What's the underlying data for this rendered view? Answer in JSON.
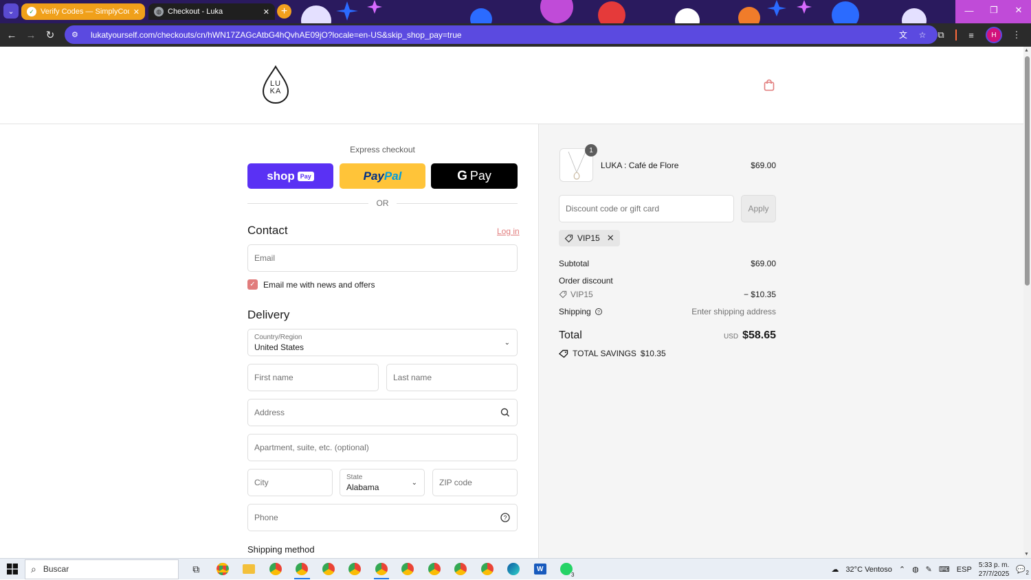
{
  "browser": {
    "tabs": [
      {
        "title": "Verify Codes — SimplyCodes",
        "active": false
      },
      {
        "title": "Checkout - Luka",
        "active": true
      }
    ],
    "url": "lukatyourself.com/checkouts/cn/hWN17ZAGcAtbG4hQvhAE09jO?locale=en-US&skip_shop_pay=true",
    "profile_initial": "H",
    "accent": "#5b4ae0"
  },
  "header": {
    "logo_line1": "LU",
    "logo_line2": "KA"
  },
  "express": {
    "label": "Express checkout",
    "shop_pay": "shop",
    "shop_pay_tag": "Pay",
    "paypal_a": "Pay",
    "paypal_b": "Pal",
    "gpay_g": "G",
    "gpay_text": "Pay",
    "or": "OR"
  },
  "contact": {
    "title": "Contact",
    "login": "Log in",
    "email_placeholder": "Email",
    "newsletter_label": "Email me with news and offers",
    "newsletter_checked": true
  },
  "delivery": {
    "title": "Delivery",
    "country_label": "Country/Region",
    "country_value": "United States",
    "first_name": "First name",
    "last_name": "Last name",
    "address": "Address",
    "apartment": "Apartment, suite, etc. (optional)",
    "city": "City",
    "state_label": "State",
    "state_value": "Alabama",
    "zip": "ZIP code",
    "phone": "Phone"
  },
  "shipping_method": {
    "title": "Shipping method"
  },
  "summary": {
    "product_name": "LUKA : Café de Flore",
    "product_qty": "1",
    "product_price": "$69.00",
    "discount_placeholder": "Discount code or gift card",
    "apply": "Apply",
    "code": "VIP15",
    "subtotal_label": "Subtotal",
    "subtotal_value": "$69.00",
    "order_discount_label": "Order discount",
    "discount_code": "VIP15",
    "discount_value": "− $10.35",
    "shipping_label": "Shipping",
    "shipping_value": "Enter shipping address",
    "total_label": "Total",
    "total_currency": "USD",
    "total_value": "$58.65",
    "savings_label": "TOTAL SAVINGS",
    "savings_value": "$10.35",
    "accent": "#e17c7c"
  },
  "taskbar": {
    "search": "Buscar",
    "weather": "32°C  Ventoso",
    "lang": "ESP",
    "time": "5:33 p. m.",
    "date": "27/7/2025",
    "notifications": "2",
    "whatsapp_count": "3"
  }
}
